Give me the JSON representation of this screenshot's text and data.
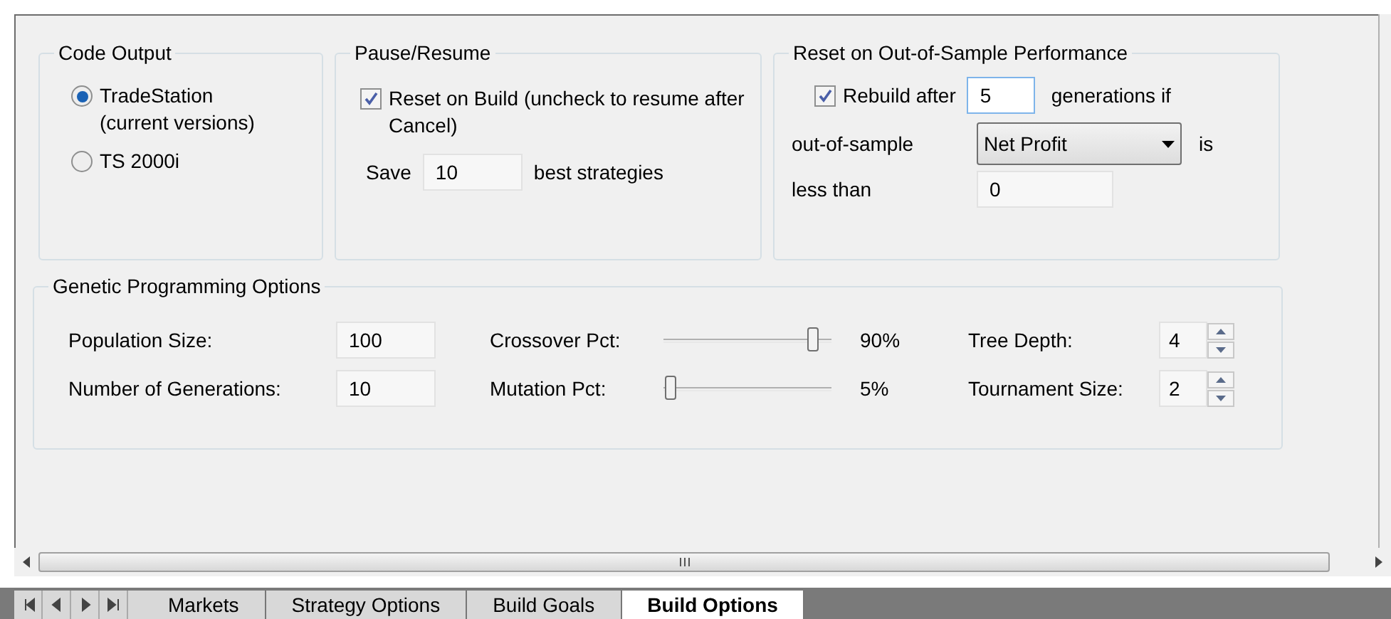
{
  "code_output": {
    "title": "Code Output",
    "options": [
      {
        "label": "TradeStation\n(current versions)",
        "selected": true
      },
      {
        "label": "TS 2000i",
        "selected": false
      }
    ]
  },
  "pause_resume": {
    "title": "Pause/Resume",
    "reset_on_build": {
      "label": "Reset on Build (uncheck to resume after Cancel)",
      "checked": true
    },
    "save_prefix": "Save",
    "save_value": "10",
    "save_suffix": "best strategies"
  },
  "reset_oos": {
    "title": "Reset on Out-of-Sample Performance",
    "rebuild": {
      "label": "Rebuild after",
      "checked": true
    },
    "rebuild_value": "5",
    "rebuild_suffix": "generations if",
    "metric_label": "out-of-sample",
    "metric_value": "Net Profit",
    "metric_suffix": "is",
    "less_than_label": "less than",
    "less_than_value": "0"
  },
  "genetic": {
    "title": "Genetic Programming Options",
    "fields": [
      {
        "label": "Population Size:",
        "value": "100"
      },
      {
        "label": "Number of Generations:",
        "value": "10"
      }
    ],
    "sliders": [
      {
        "label": "Crossover Pct:",
        "level": 0.9,
        "reading": "90%"
      },
      {
        "label": "Mutation Pct:",
        "level": 0.05,
        "reading": "5%"
      }
    ],
    "spinners": [
      {
        "label": "Tree Depth:",
        "value": "4"
      },
      {
        "label": "Tournament Size:",
        "value": "2"
      }
    ]
  },
  "sheet_tabs": [
    {
      "label": "Markets",
      "selected": false
    },
    {
      "label": "Strategy Options",
      "selected": false
    },
    {
      "label": "Build Goals",
      "selected": false
    },
    {
      "label": "Build Options",
      "selected": true
    }
  ]
}
